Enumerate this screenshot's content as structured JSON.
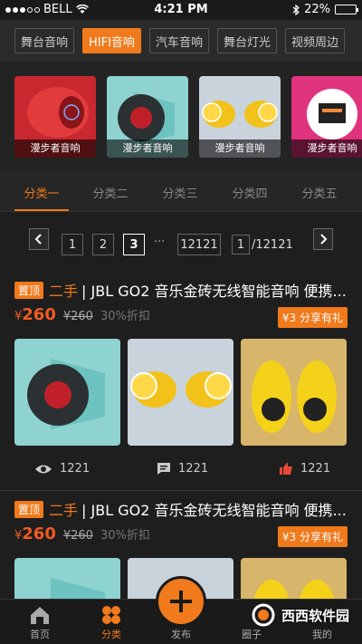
{
  "status": {
    "carrier": "BELL",
    "time": "4:21 PM",
    "battery": "22%"
  },
  "top_categories": [
    {
      "label": "舞台音响",
      "active": false
    },
    {
      "label": "HIFI音响",
      "active": true
    },
    {
      "label": "汽车音响",
      "active": false
    },
    {
      "label": "舞台灯光",
      "active": false
    },
    {
      "label": "视频周边",
      "active": false
    }
  ],
  "carousel": [
    {
      "caption": "漫步者音响"
    },
    {
      "caption": "漫步者音响"
    },
    {
      "caption": "漫步者音响"
    },
    {
      "caption": "漫步者音响"
    }
  ],
  "sub_tabs": [
    "分类一",
    "分类二",
    "分类三",
    "分类四",
    "分类五"
  ],
  "pagination": {
    "pages": [
      "1",
      "2",
      "3"
    ],
    "current": "3",
    "ellipsis": "···",
    "last": "12121",
    "jump_value": "1",
    "jump_total": "/12121"
  },
  "items": [
    {
      "tag_top": "置顶",
      "tag_used": "二手",
      "title": "| JBL GO2 音乐金砖无线智能音响 便携...",
      "currency": "¥",
      "price": "260",
      "old_price": "¥260",
      "discount": "30%折扣",
      "share": "¥3 分享有礼",
      "views": "1221",
      "comments": "1221",
      "likes": "1221"
    },
    {
      "tag_top": "置顶",
      "tag_used": "二手",
      "title": "| JBL GO2 音乐金砖无线智能音响 便携...",
      "currency": "¥",
      "price": "260",
      "old_price": "¥260",
      "discount": "30%折扣",
      "share": "¥3 分享有礼"
    }
  ],
  "bottom_nav": [
    {
      "label": "首页",
      "icon": "home-icon"
    },
    {
      "label": "分类",
      "icon": "category-icon",
      "active": true
    },
    {
      "label": "发布",
      "icon": "plus-icon"
    },
    {
      "label": "圈子",
      "icon": "circle-icon"
    },
    {
      "label": "我的",
      "icon": "user-icon"
    }
  ],
  "watermark": "西西软件园",
  "colors": {
    "accent": "#f07a1c",
    "price": "#f05a22",
    "background": "#1e1e1e"
  }
}
